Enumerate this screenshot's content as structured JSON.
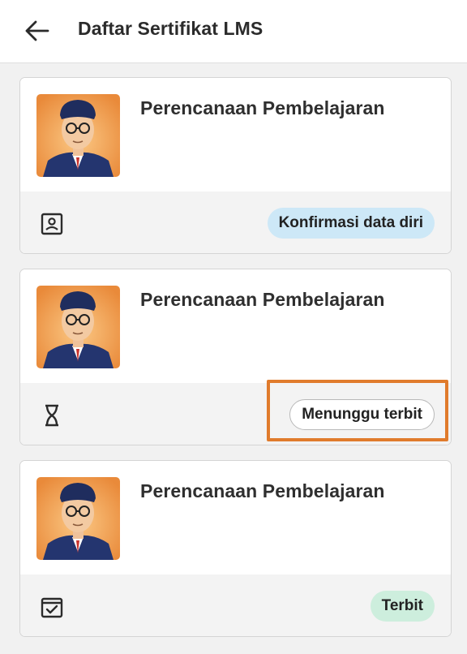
{
  "header": {
    "back_icon": "arrow-left-icon",
    "title": "Daftar Sertifikat LMS"
  },
  "certificates": [
    {
      "course_title": "Perencanaan Pembelajaran",
      "status_icon": "id-card-icon",
      "status_label": "Konfirmasi data diri",
      "badge_color": "#cde8f7"
    },
    {
      "course_title": "Perencanaan Pembelajaran",
      "status_icon": "hourglass-icon",
      "status_label": "Menunggu terbit",
      "badge_color": "#ffffff"
    },
    {
      "course_title": "Perencanaan Pembelajaran",
      "status_icon": "calendar-check-icon",
      "status_label": "Terbit",
      "badge_color": "#cdeedd"
    }
  ],
  "highlight_color": "#e07b2c"
}
